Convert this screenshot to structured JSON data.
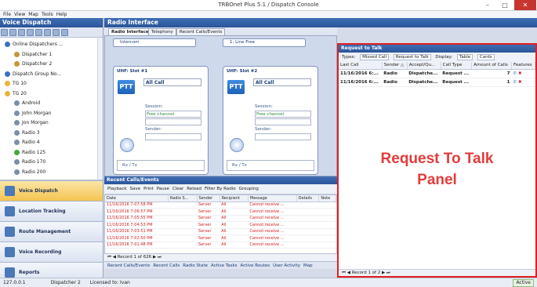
{
  "window": {
    "title": "TRBOnet Plus 5.1 / Dispatch Console",
    "min": "–",
    "max": "□",
    "close": "✕"
  },
  "menu": [
    "File",
    "View",
    "Map",
    "Tools",
    "Help"
  ],
  "sidebar": {
    "header": "Voice Dispatch",
    "tree": [
      {
        "label": "Online Dispatchers ...",
        "indent": 0,
        "color": "#3a70c2"
      },
      {
        "label": "Dispatcher 1",
        "indent": 1,
        "color": "#c6963a"
      },
      {
        "label": "Dispatcher 2",
        "indent": 1,
        "color": "#c6963a"
      },
      {
        "label": "Dispatch Group No...",
        "indent": 0,
        "color": "#3a70c2"
      },
      {
        "label": "TG 10",
        "indent": 0,
        "color": "#e8b53a"
      },
      {
        "label": "TG 20",
        "indent": 0,
        "color": "#e8b53a"
      },
      {
        "label": "Android",
        "indent": 1,
        "color": "#7d8fa8"
      },
      {
        "label": "John Morgan",
        "indent": 1,
        "color": "#7d8fa8"
      },
      {
        "label": "Jon Morgan",
        "indent": 1,
        "color": "#7d8fa8"
      },
      {
        "label": "Radio 3",
        "indent": 1,
        "color": "#7d8fa8"
      },
      {
        "label": "Radio 4",
        "indent": 1,
        "color": "#7d8fa8"
      },
      {
        "label": "Radio 125",
        "indent": 1,
        "color": "#46a63a"
      },
      {
        "label": "Radio 170",
        "indent": 1,
        "color": "#7d8fa8"
      },
      {
        "label": "Radio 200",
        "indent": 1,
        "color": "#7d8fa8"
      }
    ],
    "nav": [
      "Voice Dispatch",
      "Location Tracking",
      "Route Management",
      "Voice Recording",
      "Reports"
    ]
  },
  "radio_interface": {
    "header": "Radio Interface",
    "tabs": [
      "Radio Interface",
      "Telephony",
      "Recent Calls/Events"
    ],
    "intercom": "Intercom",
    "line": "1: Line Free",
    "slots": [
      {
        "title": "UHF: Slot #1",
        "ptt": "PTT",
        "call": "All Call",
        "session_label": "Session:",
        "session_value": "Free channel",
        "sender_label": "Sender:",
        "rx": "Rx / Tx"
      },
      {
        "title": "UHF: Slot #2",
        "ptt": "PTT",
        "call": "All Call",
        "session_label": "Session:",
        "session_value": "Free channel",
        "sender_label": "Sender:",
        "rx": "Rx / Tx"
      }
    ]
  },
  "recent": {
    "header": "Recent Calls/Events",
    "toolbar": [
      "Playback",
      "Save",
      "Print",
      "Pause",
      "Clear",
      "Reload",
      "Filter By Radio",
      "Grouping"
    ],
    "columns": [
      "Date",
      "Radio S...",
      "Sender",
      "Recipient",
      "Message",
      "Details",
      "Note"
    ],
    "rows": [
      [
        "11/16/2016 7:07:58 PM",
        "",
        "Server",
        "All",
        "Cannot receive ...",
        "",
        ""
      ],
      [
        "11/16/2016 7:06:57 PM",
        "",
        "Server",
        "All",
        "Cannot receive ...",
        "",
        ""
      ],
      [
        "11/16/2016 7:05:55 PM",
        "",
        "Server",
        "All",
        "Cannot receive ...",
        "",
        ""
      ],
      [
        "11/16/2016 7:04:53 PM",
        "",
        "Server",
        "All",
        "Cannot receive ...",
        "",
        ""
      ],
      [
        "11/16/2016 7:03:51 PM",
        "",
        "Server",
        "All",
        "Cannot receive ...",
        "",
        ""
      ],
      [
        "11/16/2016 7:02:50 PM",
        "",
        "Server",
        "All",
        "Cannot receive ...",
        "",
        ""
      ],
      [
        "11/16/2016 7:01:48 PM",
        "",
        "Server",
        "All",
        "Cannot receive ...",
        "",
        ""
      ]
    ],
    "pager": "Record 1 of 626",
    "bottom_tabs": [
      "Recent Calls/Events",
      "Recent Calls",
      "Radio State",
      "Active Tasks",
      "Active Routes",
      "User Activity",
      "Map"
    ]
  },
  "rtt": {
    "header": "Request to Talk",
    "types_label": "Types:",
    "filters": [
      "Missed Call",
      "Request to Talk"
    ],
    "display_label": "Display:",
    "display": [
      "Table",
      "Cards"
    ],
    "columns": [
      "Last Call",
      "Sender △",
      "Accept/Qu...",
      "Call Type",
      "Amount of Calls",
      "Features"
    ],
    "rows": [
      {
        "last": "11/16/2016 6:...",
        "sender": "Radio",
        "accept": "Dispatche...",
        "type": "Request ...",
        "amount": "7"
      },
      {
        "last": "11/16/2016 6:...",
        "sender": "Radio",
        "accept": "Dispatche...",
        "type": "Request ...",
        "amount": "1"
      }
    ],
    "big_label_1": "Request To Talk",
    "big_label_2": "Panel",
    "pager": "Record 1 of 2"
  },
  "status": {
    "ip": "127.0.0.1",
    "dispatcher": "Dispatcher 2",
    "license": "Licensed to: Ivan",
    "state": "Active"
  }
}
